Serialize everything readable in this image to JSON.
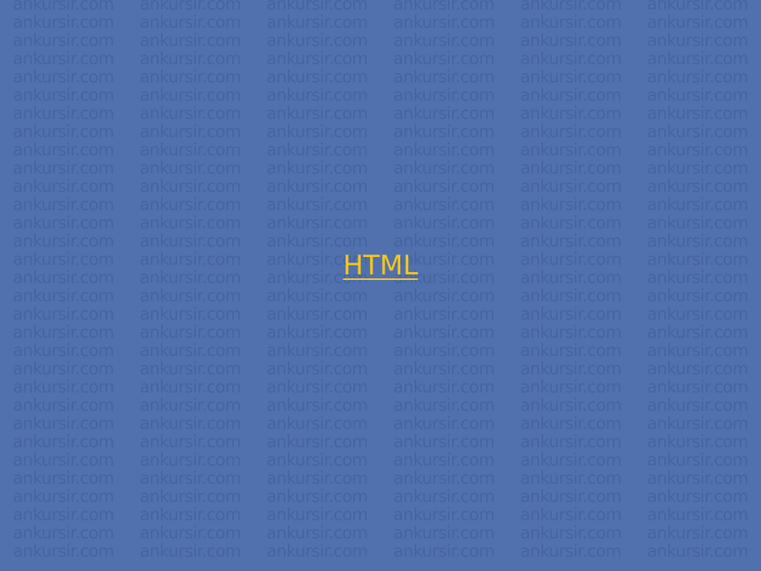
{
  "slide": {
    "background_color": "#5071ae",
    "watermark_text": "ankursir.com",
    "watermark_color": "#45649f",
    "title_link": "HTML",
    "title_color": "#f5c61d"
  }
}
